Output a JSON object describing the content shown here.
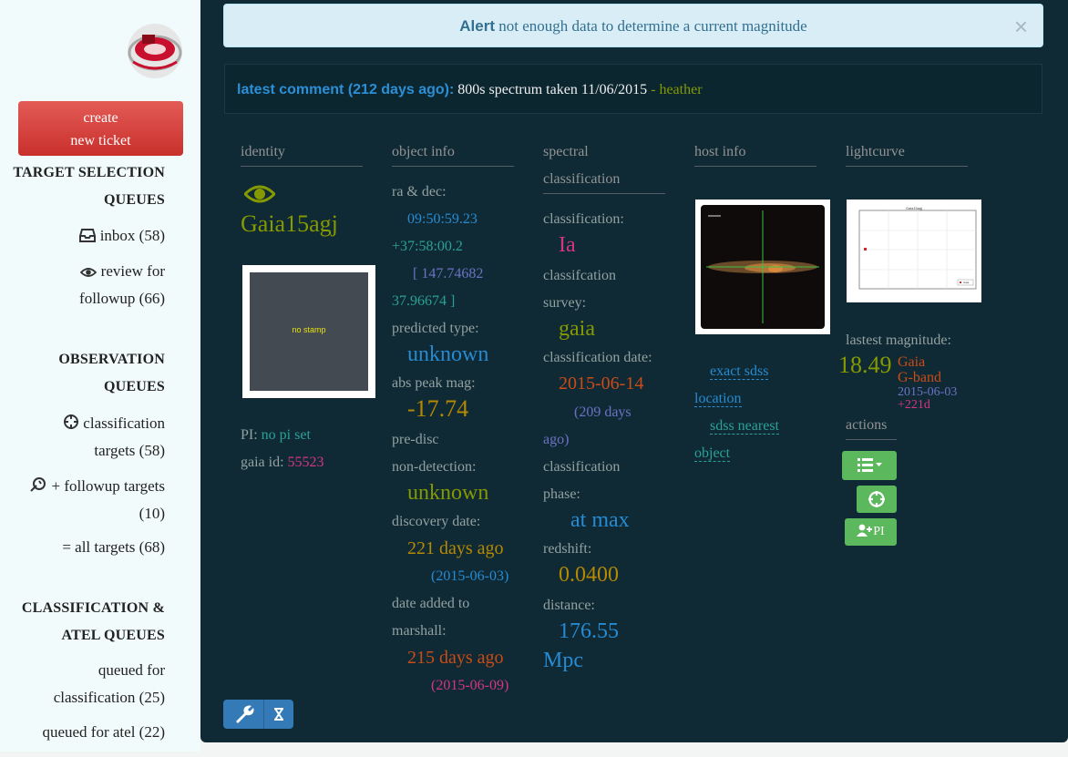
{
  "sidebar": {
    "create_ticket_line1": "create",
    "create_ticket_line2": "new ticket",
    "target_selection_heading_1": "TARGET SELECTION",
    "target_selection_heading_2": "QUEUES",
    "inbox": "inbox (58)",
    "review_1": "review for",
    "review_2": "followup (66)",
    "observation_heading_1": "OBSERVATION",
    "observation_heading_2": "QUEUES",
    "classification_targets_1": "classification",
    "classification_targets_2": "targets (58)",
    "followup_targets_1": "+ followup targets",
    "followup_targets_2": "(10)",
    "all_targets": "= all targets (68)",
    "classification_heading_1": "CLASSIFICATION &",
    "classification_heading_2": "ATEL QUEUES",
    "queued_classification_1": "queued for",
    "queued_classification_2": "classification (25)",
    "queued_atel": "queued for atel (22)"
  },
  "alert": {
    "strong": "Alert",
    "message": " not enough data to determine a current magnitude",
    "close": "×"
  },
  "comment": {
    "heading": "latest comment (212 days ago):",
    "text": " 800s spectrum taken 11/06/2015 ",
    "author": "- heather"
  },
  "identity": {
    "header": "identity",
    "name": "Gaia15agj",
    "stamp_text": "no stamp",
    "pi_label": "PI: ",
    "pi_value": "no pi set",
    "gaia_label": "gaia id: ",
    "gaia_value": "55523"
  },
  "object_info": {
    "header": "object info",
    "radec_label": "ra & dec:",
    "ra": "09:50:59.23",
    "dec": "+37:58:00.2",
    "deg_1": "[ 147.74682",
    "deg_2": "37.96674 ]",
    "predicted_label": "predicted type:",
    "predicted_value": "unknown",
    "abs_label": "abs peak mag:",
    "abs_value": "-17.74",
    "prediscovery_label_1": "pre-disc",
    "prediscovery_label_2": "non-detection:",
    "prediscovery_value": "unknown",
    "discovery_label": "discovery date:",
    "discovery_value": "221 days ago",
    "discovery_date": "(2015-06-03)",
    "added_label_1": "date added to",
    "added_label_2": "marshall:",
    "added_value": "215 days ago",
    "added_date": "(2015-06-09)"
  },
  "spectral": {
    "header_1": "spectral",
    "header_2": "classification",
    "class_label": "classification:",
    "class_value": "Ia",
    "survey_label_1": "classifcation",
    "survey_label_2": "survey:",
    "survey_value": "gaia",
    "date_label": "classification date:",
    "date_value": "2015-06-14",
    "date_ago_1": "(209 days",
    "date_ago_2": "ago)",
    "phase_label_1": "classification",
    "phase_label_2": "phase:",
    "phase_value": "at max",
    "redshift_label": "redshift:",
    "redshift_value": "0.0400",
    "distance_label": "distance:",
    "distance_value": "176.55",
    "distance_unit": "Mpc"
  },
  "host": {
    "header": "host info",
    "link1_a": "exact sdss",
    "link1_b": "location",
    "link2_a": "sdss nearest",
    "link2_b": "object"
  },
  "lightcurve": {
    "header": "lightcurve",
    "plot_title": "Gaia15agj",
    "plot_legend": "Gaia",
    "mag_label": "lastest magnitude:",
    "mag_value": "18.49",
    "mag_band_1": "Gaia",
    "mag_band_2": "G-band",
    "mag_date": "2015-06-03",
    "mag_ago": "+221d",
    "actions_header": "actions",
    "pi_button": "PI"
  },
  "colors": {
    "main_bg": "#0f2a35",
    "sidebar_bg": "#f1fbfb",
    "green": "#859900",
    "blue": "#268bd2",
    "magenta": "#d33682",
    "orange": "#cb4b16",
    "yellow": "#b58900",
    "cyan": "#2aa198",
    "violet": "#6c71c4"
  }
}
